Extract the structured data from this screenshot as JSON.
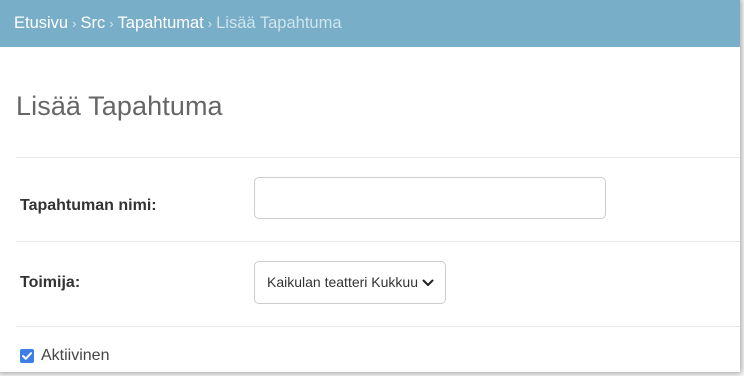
{
  "breadcrumbs": {
    "home": "Etusivu",
    "app": "Src",
    "model": "Tapahtumat",
    "current": "Lisää Tapahtuma",
    "separator": "›"
  },
  "page": {
    "title": "Lisää Tapahtuma"
  },
  "form": {
    "name_field": {
      "label": "Tapahtuman nimi:",
      "value": ""
    },
    "actor_field": {
      "label": "Toimija:",
      "selected": "Kaikulan teatteri Kukkuu"
    },
    "active_field": {
      "label": "Aktiivinen",
      "checked": true
    }
  },
  "colors": {
    "header_bg": "#79aec8",
    "checkbox_accent": "#3d7ee8"
  }
}
